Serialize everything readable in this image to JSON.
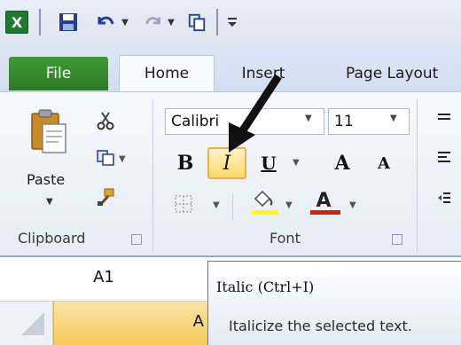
{
  "quick_access": {
    "app_icon": "excel-logo-icon",
    "app_icon_glyph": "X",
    "items": [
      "save-icon",
      "undo-icon",
      "redo-icon",
      "copy-icon",
      "customize-qat-icon"
    ]
  },
  "tabs": {
    "file": "File",
    "home": "Home",
    "insert": "Insert",
    "page_layout": "Page Layout"
  },
  "clipboard": {
    "paste_label": "Paste",
    "group_label": "Clipboard",
    "icons": [
      "cut-icon",
      "copy-icon",
      "format-painter-icon"
    ]
  },
  "font": {
    "group_label": "Font",
    "font_name": "Calibri",
    "font_size": "11",
    "bold_label": "B",
    "italic_label": "I",
    "underline_label": "U",
    "grow_label": "A",
    "shrink_label": "A",
    "font_color_label": "A",
    "highlight_color": "#ffff00",
    "font_color": "#e8141b"
  },
  "formula_bar": {
    "name_box": "A1"
  },
  "grid": {
    "column_a": "A"
  },
  "tooltip": {
    "title": "Italic (Ctrl+I)",
    "description": "Italicize the selected text."
  },
  "colors": {
    "file_tab": "#2b7a22",
    "selected_button": "#ffd86a",
    "selected_header": "#f7c95c"
  }
}
